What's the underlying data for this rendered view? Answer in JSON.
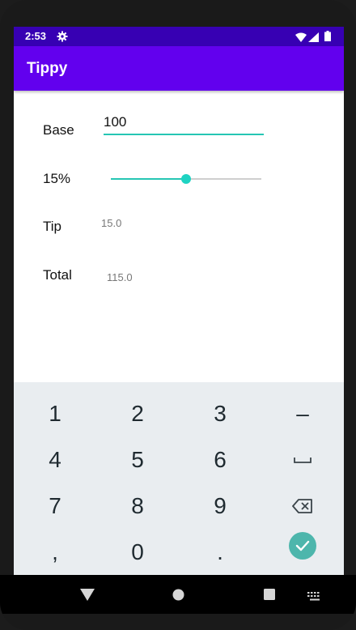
{
  "status_bar": {
    "time": "2:53",
    "icons": [
      "gear-icon",
      "wifi-icon",
      "signal-icon",
      "battery-icon"
    ]
  },
  "app_bar": {
    "title": "Tippy"
  },
  "form": {
    "base_label": "Base",
    "base_value": "100",
    "percent_label": "15%",
    "tip_percent_slider": {
      "value": 15,
      "max": 30
    },
    "tip_label": "Tip",
    "tip_value": "15.0",
    "total_label": "Total",
    "total_value": "115.0"
  },
  "keyboard": {
    "rows": [
      [
        "1",
        "2",
        "3",
        "–"
      ],
      [
        "4",
        "5",
        "6",
        "space-icon"
      ],
      [
        "7",
        "8",
        "9",
        "backspace-icon"
      ],
      [
        ",",
        "0",
        ".",
        "done-icon"
      ]
    ]
  },
  "colors": {
    "status_bar": "#3700b3",
    "app_bar": "#6200ee",
    "accent": "#26c6b4",
    "keyboard_bg": "#e9edf0",
    "done_button": "#4db6ac"
  },
  "nav_bar": {
    "icons": [
      "back-icon",
      "home-icon",
      "recents-icon",
      "keyboard-icon"
    ]
  }
}
